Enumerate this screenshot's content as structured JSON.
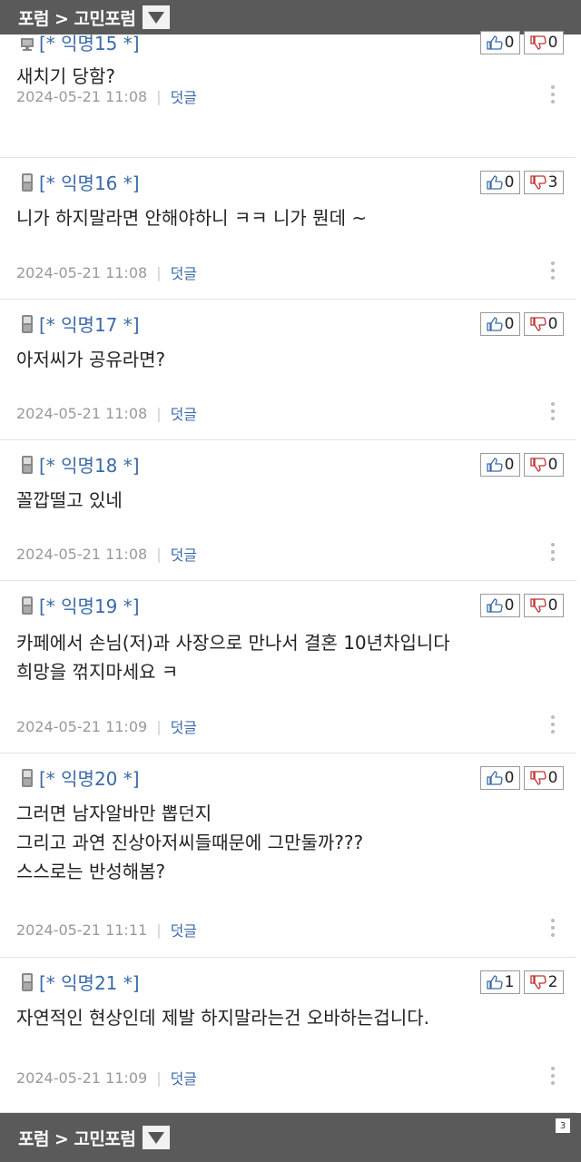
{
  "nav": {
    "forum": "포럼",
    "separator": ">",
    "board": "고민포럼",
    "page_badge": "3"
  },
  "comments": [
    {
      "author": "[* 익명15 *]",
      "device": "desktop",
      "up": "0",
      "down": "0",
      "lines": [
        "새치기 당함?"
      ],
      "date": "2024-05-21 11:08",
      "reply": "덧글"
    },
    {
      "author": "[* 익명16 *]",
      "device": "mobile",
      "up": "0",
      "down": "3",
      "lines": [
        "니가 하지말라면 안해야하니 ㅋㅋ 니가 뭔데 ~"
      ],
      "date": "2024-05-21 11:08",
      "reply": "덧글"
    },
    {
      "author": "[* 익명17 *]",
      "device": "mobile",
      "up": "0",
      "down": "0",
      "lines": [
        "아저씨가 공유라면?"
      ],
      "date": "2024-05-21 11:08",
      "reply": "덧글"
    },
    {
      "author": "[* 익명18 *]",
      "device": "mobile",
      "up": "0",
      "down": "0",
      "lines": [
        "꼴깝떨고 있네"
      ],
      "date": "2024-05-21 11:08",
      "reply": "덧글"
    },
    {
      "author": "[* 익명19 *]",
      "device": "mobile",
      "up": "0",
      "down": "0",
      "lines": [
        "카페에서 손님(저)과 사장으로 만나서 결혼 10년차입니다",
        "희망을 꺾지마세요 ㅋ"
      ],
      "date": "2024-05-21 11:09",
      "reply": "덧글"
    },
    {
      "author": "[* 익명20 *]",
      "device": "mobile",
      "up": "0",
      "down": "0",
      "lines": [
        "그러면 남자알바만 뽑던지",
        "그리고 과연 진상아저씨들때문에 그만둘까???",
        "스스로는 반성해봄?"
      ],
      "date": "2024-05-21 11:11",
      "reply": "덧글"
    },
    {
      "author": "[* 익명21 *]",
      "device": "mobile",
      "up": "1",
      "down": "2",
      "lines": [
        "자연적인 현상인데 제발 하지말라는건 오바하는겁니다."
      ],
      "date": "2024-05-21 11:09",
      "reply": "덧글"
    }
  ]
}
